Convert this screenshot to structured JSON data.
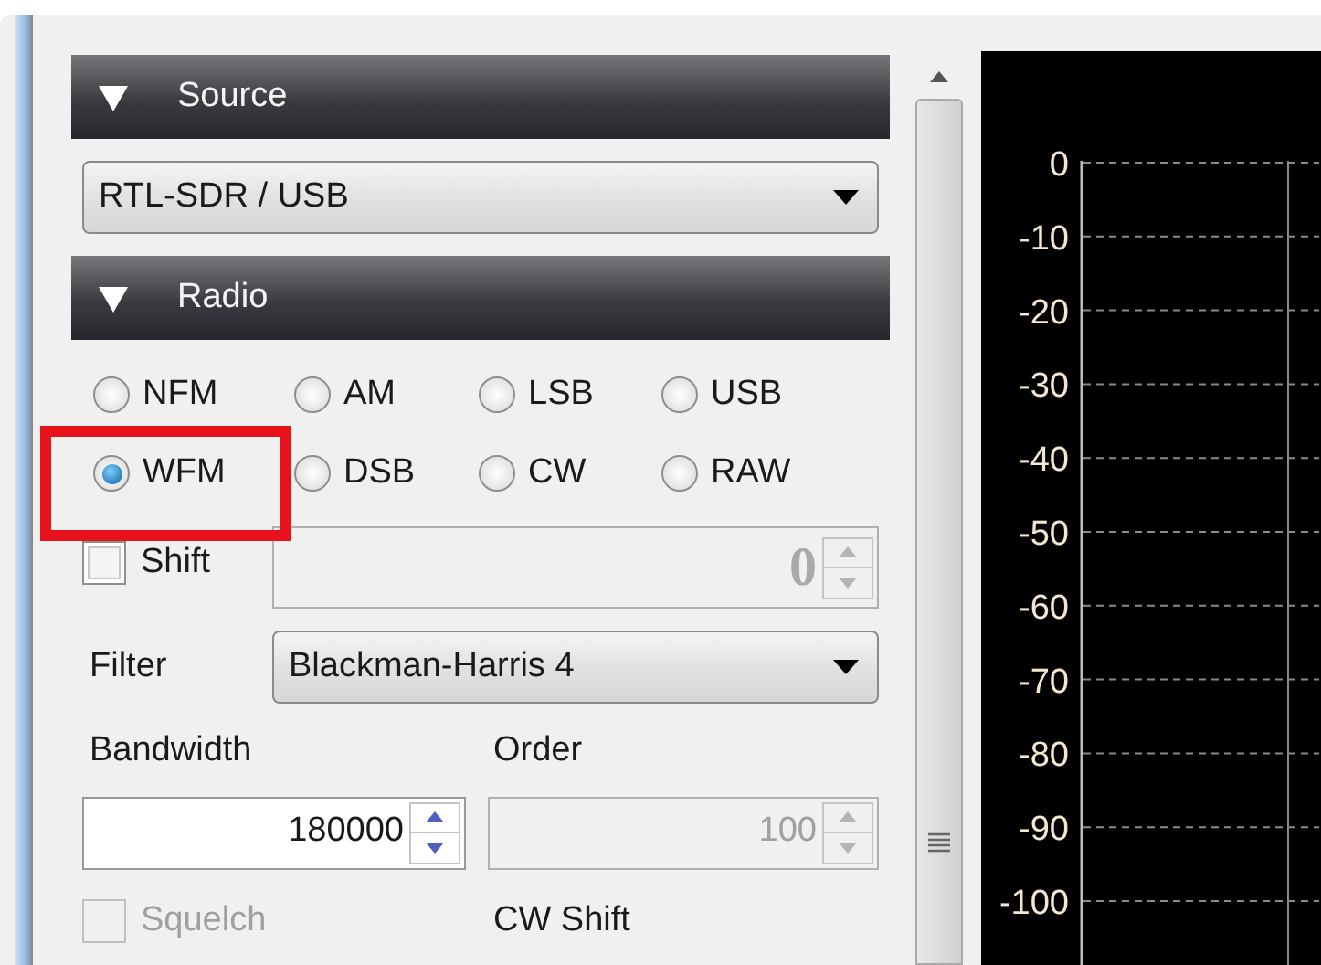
{
  "source": {
    "title": "Source",
    "expanded": true,
    "device": "RTL-SDR / USB"
  },
  "radio": {
    "title": "Radio",
    "expanded": true,
    "modes": [
      {
        "label": "NFM",
        "selected": false,
        "highlighted": false
      },
      {
        "label": "AM",
        "selected": false,
        "highlighted": false
      },
      {
        "label": "LSB",
        "selected": false,
        "highlighted": false
      },
      {
        "label": "USB",
        "selected": false,
        "highlighted": false
      },
      {
        "label": "WFM",
        "selected": true,
        "highlighted": true
      },
      {
        "label": "DSB",
        "selected": false,
        "highlighted": false
      },
      {
        "label": "CW",
        "selected": false,
        "highlighted": false
      },
      {
        "label": "RAW",
        "selected": false,
        "highlighted": false
      }
    ],
    "shift": {
      "label": "Shift",
      "checked": false,
      "disabled": false,
      "field": {
        "value": "0",
        "disabled": true
      }
    },
    "filter": {
      "label": "Filter",
      "value": "Blackman-Harris 4"
    },
    "bandwidth": {
      "label": "Bandwidth",
      "value": "180000",
      "disabled": false
    },
    "order": {
      "label": "Order",
      "value": "100",
      "disabled": true
    },
    "squelch": {
      "label": "Squelch",
      "checked": false,
      "disabled": true
    },
    "cw_shift": {
      "label": "CW Shift"
    }
  },
  "spectrum": {
    "y_labels": [
      "0",
      "-10",
      "-20",
      "-30",
      "-40",
      "-50",
      "-60",
      "-70",
      "-80",
      "-90",
      "-100"
    ]
  }
}
